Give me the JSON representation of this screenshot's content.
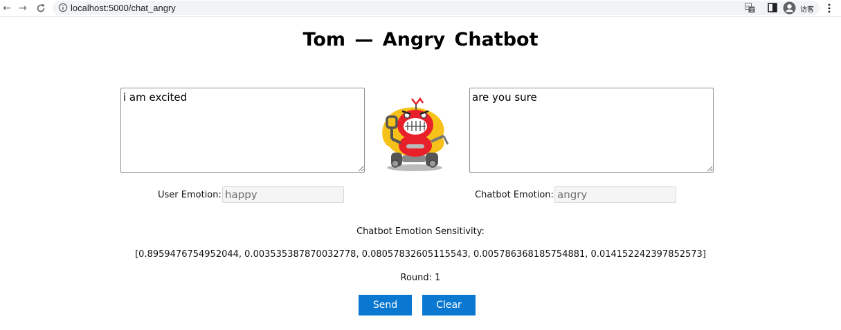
{
  "browser": {
    "url": "localhost:5000/chat_angry",
    "profile_label": "访客",
    "icons": [
      "back-arrow-icon",
      "forward-arrow-icon",
      "reload-icon",
      "info-icon",
      "translate-icon",
      "side-panel-icon",
      "profile-icon",
      "menu-icon"
    ]
  },
  "page": {
    "title": "Tom  —  Angry Chatbot",
    "user_message": "i am excited",
    "bot_message": "are you sure",
    "user_emotion_label": "User Emotion:",
    "user_emotion_value": "happy",
    "bot_emotion_label": "Chatbot Emotion:",
    "bot_emotion_value": "angry",
    "sensitivity_label": "Chatbot Emotion Sensitivity:",
    "sensitivity_values": "[0.8959476754952044, 0.003535387870032778, 0.08057832605115543, 0.005786368185754881, 0.014152242397852573]",
    "round_text": "Round: 1",
    "send_label": "Send",
    "clear_label": "Clear",
    "robot_image": "angry-robot-illustration"
  },
  "colors": {
    "button": "#0a78d1",
    "robot_body": "#e8202a",
    "robot_splash": "#f6c21a"
  }
}
